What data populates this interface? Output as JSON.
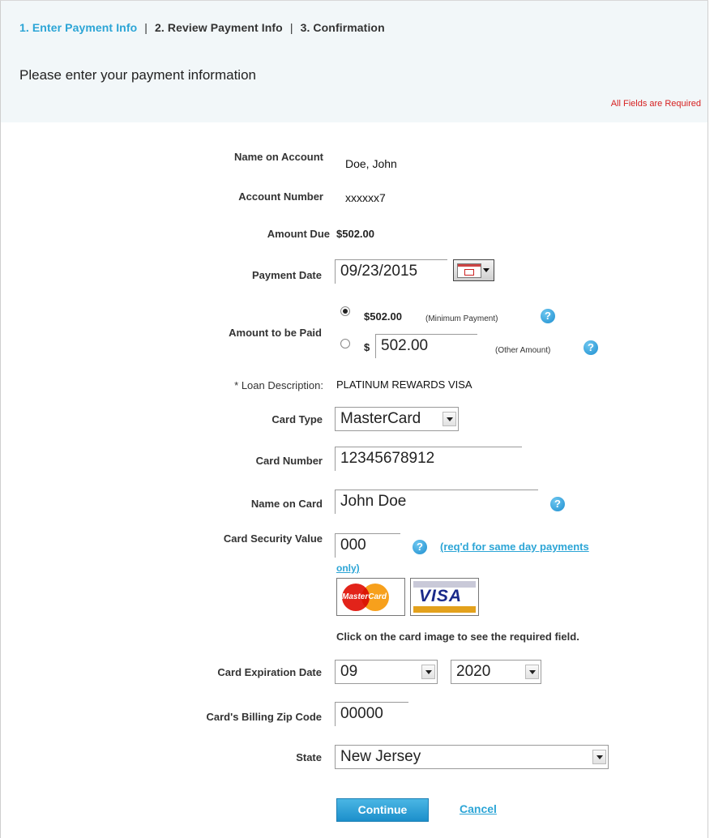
{
  "steps": {
    "step1": "1. Enter Payment Info",
    "step2": "2. Review Payment Info",
    "step3": "3. Confirmation",
    "separator": "|"
  },
  "intro": "Please enter your payment information",
  "required_note": "All Fields are Required",
  "form": {
    "name_on_account": {
      "label": "Name on Account",
      "value": "Doe, John"
    },
    "account_number": {
      "label": "Account Number",
      "value": "xxxxxx7"
    },
    "amount_due": {
      "label": "Amount Due",
      "value": "$502.00"
    },
    "payment_date": {
      "label": "Payment Date",
      "value": "09/23/2015"
    },
    "amount_to_be_paid": {
      "label": "Amount to be Paid",
      "minimum_value": "$502.00",
      "minimum_note": "(Minimum Payment)",
      "currency": "$",
      "other_value": "502.00",
      "other_note": "(Other Amount)",
      "selected": "minimum"
    },
    "loan_description": {
      "label": "* Loan Description:",
      "value": "PLATINUM REWARDS VISA"
    },
    "card_type": {
      "label": "Card Type",
      "value": "MasterCard"
    },
    "card_number": {
      "label": "Card Number",
      "value": "12345678912"
    },
    "name_on_card": {
      "label": "Name on Card",
      "value": "John Doe"
    },
    "card_security_value": {
      "label": "Card Security Value",
      "value": "000",
      "link_line1": "(req'd for same day payments",
      "link_line2": "only)"
    },
    "card_images": {
      "mastercard": "MasterCard",
      "visa": "VISA",
      "hint": "Click on the card image to see the required field."
    },
    "card_expiration_date": {
      "label": "Card Expiration Date",
      "month": "09",
      "year": "2020"
    },
    "billing_zip": {
      "label": "Card's Billing Zip Code",
      "value": "00000"
    },
    "state": {
      "label": "State",
      "value": "New Jersey"
    }
  },
  "actions": {
    "continue": "Continue",
    "cancel": "Cancel"
  },
  "icons": {
    "help": "?"
  },
  "colors": {
    "accent": "#2ca5d6",
    "required": "#d62020",
    "header_bg": "#f2f7f9"
  }
}
